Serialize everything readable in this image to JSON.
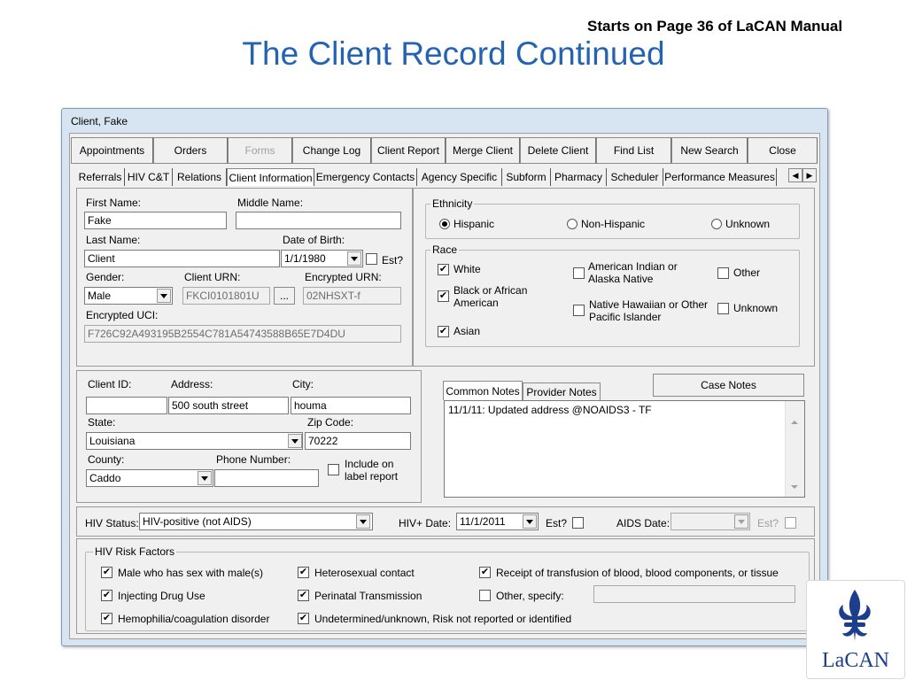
{
  "slide": {
    "note": "Starts on Page 36 of LaCAN Manual",
    "title": "The Client Record Continued",
    "logo_text": "LaCAN"
  },
  "window": {
    "title": "Client, Fake"
  },
  "toolbar": {
    "appointments": "Appointments",
    "orders": "Orders",
    "forms": "Forms",
    "change_log": "Change Log",
    "client_report": "Client Report",
    "merge_client": "Merge Client",
    "delete_client": "Delete Client",
    "find_list": "Find List",
    "new_search": "New Search",
    "close": "Close"
  },
  "tabs": {
    "referrals": "Referrals",
    "hiv_ct": "HIV C&T",
    "relations": "Relations",
    "client_information": "Client Information",
    "emergency_contacts": "Emergency Contacts",
    "agency_specific": "Agency Specific",
    "subform": "Subform",
    "pharmacy": "Pharmacy",
    "scheduler": "Scheduler",
    "performance_measures": "Performance Measures"
  },
  "identity": {
    "first_name_label": "First Name:",
    "first_name": "Fake",
    "middle_name_label": "Middle Name:",
    "middle_name": "",
    "last_name_label": "Last Name:",
    "last_name": "Client",
    "dob_label": "Date of Birth:",
    "dob": "1/1/1980",
    "est_label": "Est?",
    "gender_label": "Gender:",
    "gender": "Male",
    "client_urn_label": "Client URN:",
    "client_urn": "FKCI0101801U",
    "urn_button": "...",
    "encrypted_urn_label": "Encrypted URN:",
    "encrypted_urn": "02NHSXT-f",
    "encrypted_uci_label": "Encrypted UCI:",
    "encrypted_uci": "F726C92A493195B2554C781A54743588B65E7D4DU"
  },
  "ethnicity": {
    "legend": "Ethnicity",
    "hispanic": "Hispanic",
    "non_hispanic": "Non-Hispanic",
    "unknown": "Unknown",
    "selected": "hispanic"
  },
  "race": {
    "legend": "Race",
    "white": "White",
    "white_checked": true,
    "american_indian": [
      "American Indian or",
      "Alaska Native"
    ],
    "american_indian_checked": false,
    "other": "Other",
    "other_checked": false,
    "black": [
      "Black or African",
      "American"
    ],
    "black_checked": true,
    "native_hawaiian": [
      "Native Hawaiian or Other",
      "Pacific Islander"
    ],
    "native_hawaiian_checked": false,
    "unknown": "Unknown",
    "unknown_checked": false,
    "asian": "Asian",
    "asian_checked": true
  },
  "address": {
    "client_id_label": "Client ID:",
    "client_id": "",
    "address_label": "Address:",
    "address": "500 south street",
    "city_label": "City:",
    "city": "houma",
    "state_label": "State:",
    "state": "Louisiana",
    "zip_label": "Zip Code:",
    "zip": "70222",
    "county_label": "County:",
    "county": "Caddo",
    "phone_label": "Phone Number:",
    "phone": "",
    "include_label": [
      "Include on",
      "label report"
    ]
  },
  "notes": {
    "tab_common": "Common Notes",
    "tab_provider": "Provider Notes",
    "case_notes_button": "Case Notes",
    "content": "11/1/11: Updated address @NOAIDS3 - TF"
  },
  "hiv": {
    "status_label": "HIV Status:",
    "status": "HIV-positive (not AIDS)",
    "hiv_date_label": "HIV+ Date:",
    "hiv_date": "11/1/2011",
    "est_label": "Est?",
    "aids_date_label": "AIDS Date:",
    "aids_date": "",
    "aids_est_label": "Est?"
  },
  "risk_factors": {
    "legend": "HIV Risk Factors",
    "msm": "Male who has sex with male(s)",
    "heterosexual": "Heterosexual contact",
    "transfusion": "Receipt of transfusion of blood, blood components, or tissue",
    "idu": "Injecting Drug Use",
    "perinatal": "Perinatal Transmission",
    "other": "Other, specify:",
    "other_value": "",
    "hemophilia": "Hemophilia/coagulation disorder",
    "undetermined": "Undetermined/unknown, Risk not reported or identified"
  },
  "icons": {
    "check": "✔",
    "left_arrow": "◀",
    "right_arrow": "▶"
  }
}
